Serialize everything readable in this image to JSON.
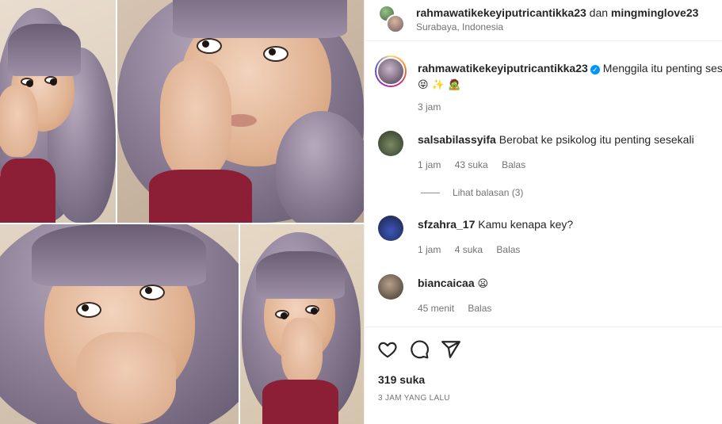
{
  "post": {
    "header": {
      "author1": "rahmawatikekeyiputricantikka23",
      "joiner": "dan",
      "author2": "mingminglove23",
      "location": "Surabaya, Indonesia"
    },
    "caption": {
      "username": "rahmawatikekeyiputricantikka23",
      "verified_icon": "verified-badge-icon",
      "text": "Menggila itu penting sesek",
      "emojis": "😝 ✨ 🧟",
      "time": "3 jam"
    },
    "comments": [
      {
        "username": "salsabilassyifa",
        "text": "Berobat ke psikolog itu penting sesekali",
        "time": "1 jam",
        "likes": "43 suka",
        "reply": "Balas",
        "view_replies": "Lihat balasan (3)"
      },
      {
        "username": "sfzahra_17",
        "text": "Kamu kenapa key?",
        "time": "1 jam",
        "likes": "4 suka",
        "reply": "Balas"
      },
      {
        "username": "biancaicaa",
        "text": "😦",
        "time": "45 menit",
        "reply": "Balas"
      }
    ],
    "actions": {
      "like_icon": "heart-icon",
      "comment_icon": "comment-icon",
      "share_icon": "send-icon"
    },
    "likes": "319 suka",
    "posted": "3 JAM YANG LALU"
  },
  "colors": {
    "text": "#262626",
    "secondary": "#737373",
    "verified": "#0095f6",
    "border": "#efefef",
    "hair": "#8d7f96",
    "shirt": "#8c1f35"
  }
}
